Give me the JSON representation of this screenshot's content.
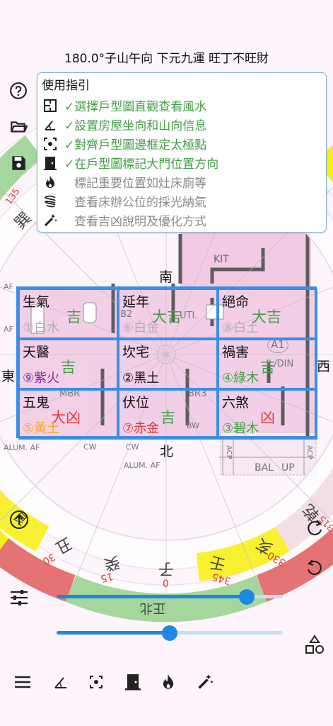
{
  "header": {
    "title": "180.0°子山午向 下元九運 旺丁不旺財"
  },
  "guide": {
    "title": "使用指引",
    "items": [
      {
        "text": "✓選擇戶型圖直觀查看風水",
        "icon": "floorplan-icon",
        "done": true
      },
      {
        "text": "✓設置房屋坐向和山向信息",
        "icon": "angle-icon",
        "done": true
      },
      {
        "text": "✓對齊戶型圖邊框定太極點",
        "icon": "center-focus-icon",
        "done": true
      },
      {
        "text": "✓在戶型圖標記大門位置方向",
        "icon": "door-icon",
        "done": true
      },
      {
        "text": "標記重要位置如灶床廁等",
        "icon": "fire-icon",
        "done": false
      },
      {
        "text": "查看床辦公位的採光納氣",
        "icon": "wind-icon",
        "done": false
      },
      {
        "text": "查看吉凶說明及優化方式",
        "icon": "magic-wand-icon",
        "done": false
      }
    ]
  },
  "directions": {
    "south": "南",
    "north": "北",
    "east": "東",
    "west": "西"
  },
  "grid": [
    {
      "name": "生氣",
      "luck": "吉",
      "star": "①白水",
      "luck_color": "#43a047",
      "star_color": "#b0b0b0"
    },
    {
      "name": "延年",
      "luck": "大吉",
      "star": "⑥白金",
      "luck_color": "#43a047",
      "star_color": "#b0b0b0"
    },
    {
      "name": "絕命",
      "luck": "大吉",
      "star": "⑧白土",
      "luck_color": "#43a047",
      "star_color": "#b0b0b0"
    },
    {
      "name": "天醫",
      "luck": "吉",
      "star": "⑨紫火",
      "luck_color": "#43a047",
      "star_color": "#8e24aa"
    },
    {
      "name": "坎宅",
      "luck": "",
      "star": "②黑土",
      "luck_color": "#111111",
      "star_color": "#111111"
    },
    {
      "name": "禍害",
      "luck": "吉",
      "star": "④綠木",
      "luck_color": "#43a047",
      "star_color": "#43a047"
    },
    {
      "name": "五鬼",
      "luck": "大凶",
      "star": "⑤黃土",
      "luck_color": "#e53935",
      "star_color": "#f9a825"
    },
    {
      "name": "伏位",
      "luck": "吉",
      "star": "⑦赤金",
      "luck_color": "#43a047",
      "star_color": "#e53935"
    },
    {
      "name": "六煞",
      "luck": "凶",
      "star": "③碧木",
      "luck_color": "#e53935",
      "star_color": "#43a047"
    }
  ],
  "floorplan_labels": [
    "KIT",
    "B2",
    "UTI.",
    "A1",
    "L/DIN",
    "MBR",
    "BR3",
    "BW",
    "CW",
    "CW",
    "AF",
    "AF",
    "ALUM. AF",
    "ALUM. AF",
    "BAL",
    "UP",
    "ACP",
    "ACP"
  ],
  "compass": {
    "outer_labels": [
      "巽",
      "丑",
      "癸",
      "子",
      "壬",
      "亥",
      "乾"
    ],
    "degree_labels": [
      "135",
      "30",
      "15",
      "0",
      "345",
      "330",
      "315"
    ],
    "small_labels": [
      "艮",
      "正北"
    ]
  },
  "sliders": {
    "opacity_value": 0.84,
    "rotation_value": 0.5
  },
  "colors": {
    "accent": "#1e88e5",
    "auspicious": "#43a047",
    "inauspicious": "#e53935",
    "grid_border": "#3b8ee6",
    "ring_yellow": "#f7ef1a",
    "ring_green": "#a5d69b",
    "ring_red": "#e57373"
  },
  "bottombar": {
    "items": [
      "menu-icon",
      "angle-icon",
      "center-focus-icon",
      "door-icon",
      "fire-icon",
      "magic-wand-icon"
    ]
  }
}
